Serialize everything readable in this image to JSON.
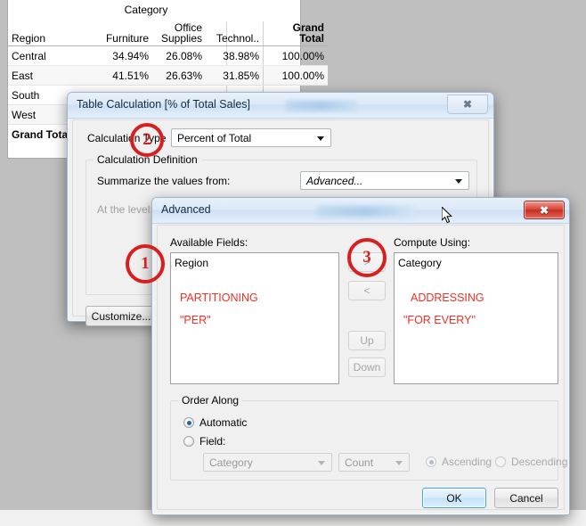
{
  "worksheet": {
    "column_group_title": "Category",
    "headers": [
      "Region",
      "Furniture",
      "Office Supplies",
      "Technol..",
      "Grand Total"
    ],
    "rows": [
      {
        "region": "Central",
        "furniture": "34.94%",
        "office": "26.08%",
        "tech": "38.98%",
        "grand": "100.00%"
      },
      {
        "region": "East",
        "furniture": "41.51%",
        "office": "26.63%",
        "tech": "31.85%",
        "grand": "100.00%"
      },
      {
        "region": "South",
        "furniture": "",
        "office": "",
        "tech": "",
        "grand": ""
      },
      {
        "region": "West",
        "furniture": "",
        "office": "",
        "tech": "",
        "grand": ""
      },
      {
        "region": "Grand Total",
        "furniture": "",
        "office": "",
        "tech": "",
        "grand": ""
      }
    ]
  },
  "table_calculation_dialog": {
    "title": "Table Calculation [% of Total Sales]",
    "close_glyph": "✖",
    "calculation_type_label": "Calculation Type",
    "calculation_type_value": "Percent of Total",
    "calculation_definition_legend": "Calculation Definition",
    "summarize_label": "Summarize the values from:",
    "summarize_value": "Advanced...",
    "at_the_level_label": "At the level:",
    "customize_button": "Customize..."
  },
  "advanced_dialog": {
    "title": "Advanced",
    "close_glyph": "✖",
    "available_fields_label": "Available Fields:",
    "available_fields_items": [
      "Region"
    ],
    "available_fields_annotations": [
      "PARTITIONING",
      "\"PER\""
    ],
    "compute_using_label": "Compute Using:",
    "compute_using_items": [
      "Category"
    ],
    "compute_using_annotations": [
      "ADDRESSING",
      "\"FOR EVERY\""
    ],
    "move_right_button": ">",
    "move_left_button": "<",
    "up_button": "Up",
    "down_button": "Down",
    "order_along_legend": "Order Along",
    "automatic_radio_label": "Automatic",
    "field_radio_label": "Field:",
    "field_select_value": "Category",
    "aggregation_select_value": "Count",
    "ascending_label": "Ascending",
    "descending_label": "Descending",
    "ok_button": "OK",
    "cancel_button": "Cancel"
  },
  "annotations": {
    "markers": [
      "1",
      "2",
      "3"
    ],
    "color": "#d81f1f"
  }
}
